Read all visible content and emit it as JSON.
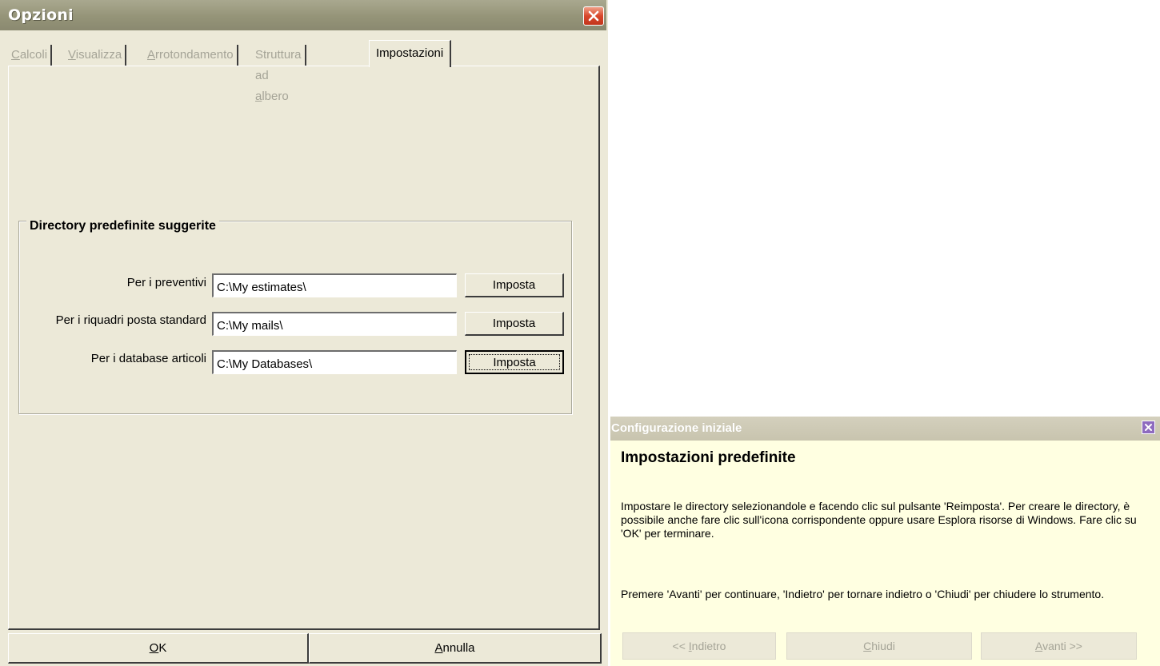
{
  "options_dialog": {
    "title": "Opzioni",
    "tabs": [
      {
        "pre": "",
        "key": "C",
        "post": "alcoli"
      },
      {
        "pre": "",
        "key": "V",
        "post": "isualizza"
      },
      {
        "pre": "",
        "key": "A",
        "post": "rrotondamento"
      },
      {
        "pre": "Struttura ad ",
        "key": "a",
        "post": "lbero"
      },
      {
        "pre": "Impostazioni",
        "key": "",
        "post": ""
      }
    ],
    "group": {
      "legend": "Directory predefinite suggerite",
      "rows": [
        {
          "label": "Per i preventivi",
          "value": "C:\\My estimates\\",
          "button": "Imposta"
        },
        {
          "label": "Per i riquadri posta standard",
          "value": "C:\\My mails\\",
          "button": "Imposta"
        },
        {
          "label": "Per i database articoli",
          "value": "C:\\My Databases\\",
          "button": "Imposta"
        }
      ]
    },
    "ok": {
      "key": "O",
      "rest": "K"
    },
    "cancel": {
      "key": "A",
      "rest": "nnulla"
    }
  },
  "config_panel": {
    "title": "Configurazione iniziale",
    "heading": "Impostazioni predefinite",
    "description": "Impostare le directory selezionandole e facendo clic sul pulsante 'Reimposta'. Per creare le directory, è possibile anche fare clic sull'icona corrispondente oppure usare Esplora risorse di Windows. Fare clic su 'OK'  per terminare.",
    "hint": "Premere 'Avanti' per continuare, 'Indietro' per tornare indietro o 'Chiudi' per chiudere lo strumento.",
    "back": {
      "pre": "<< ",
      "key": "I",
      "post": "ndietro"
    },
    "close": {
      "pre": "",
      "key": "C",
      "post": "hiudi"
    },
    "next": {
      "pre": "",
      "key": "A",
      "post": "vanti >>"
    }
  }
}
